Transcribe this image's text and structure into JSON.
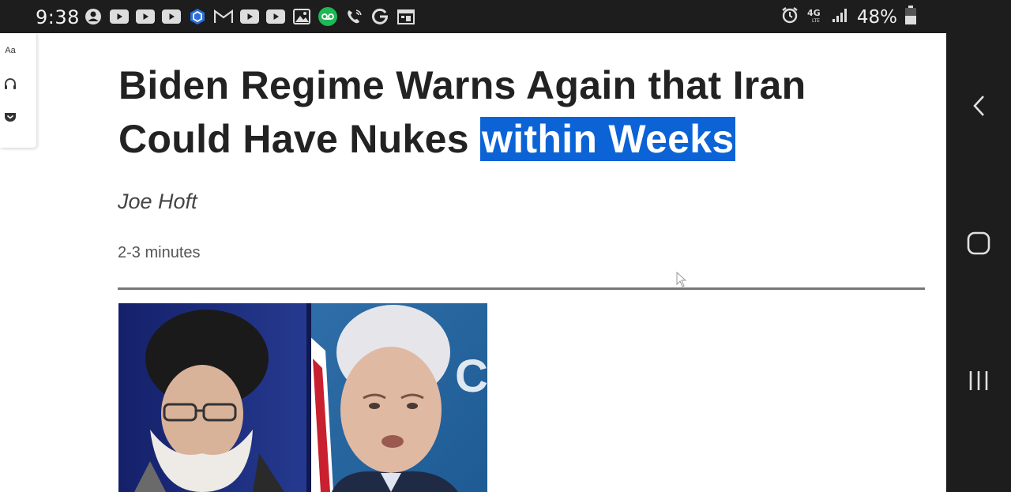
{
  "status_bar": {
    "time": "9:38",
    "battery": "48%",
    "network": "4G LTE",
    "notification_icons": [
      "account-icon",
      "youtube-icon",
      "youtube-icon",
      "youtube-icon",
      "crypto-icon",
      "gmail-icon",
      "youtube-icon",
      "youtube-icon",
      "gallery-icon",
      "voicemail-icon",
      "wifi-calling-icon",
      "google-icon",
      "calendar-icon"
    ]
  },
  "reader_tools": {
    "text_size_label": "Aa",
    "icons": [
      "text-size-icon",
      "headphones-icon",
      "pocket-icon"
    ]
  },
  "article": {
    "headline_part1": "Biden Regime Warns Again that Iran Could Have Nukes ",
    "headline_highlight": "within Weeks",
    "author": "Joe Hoft",
    "read_time": "2-3 minutes"
  },
  "nav_bar": {
    "buttons": [
      "back-icon",
      "home-icon",
      "recents-icon"
    ]
  },
  "colors": {
    "status_bg": "#1d1d1d",
    "highlight": "#0b63d6",
    "headline_text": "#222222"
  }
}
